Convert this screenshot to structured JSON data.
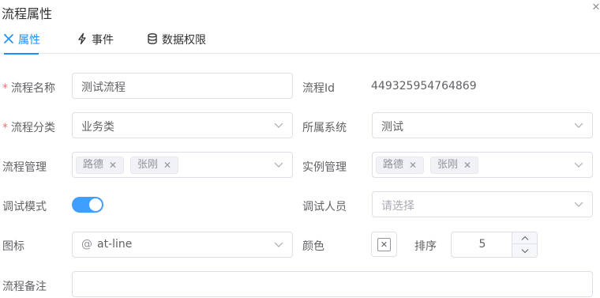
{
  "dialog": {
    "title": "流程属性",
    "close_icon": "close-icon"
  },
  "tabs": [
    {
      "label": "属性",
      "icon": "tools-icon",
      "active": true
    },
    {
      "label": "事件",
      "icon": "lightning-icon",
      "active": false
    },
    {
      "label": "数据权限",
      "icon": "database-icon",
      "active": false
    }
  ],
  "form": {
    "required_mark": "*",
    "process_name": {
      "label": "流程名称",
      "value": "测试流程"
    },
    "process_id": {
      "label": "流程Id",
      "value": "449325954764869"
    },
    "process_category": {
      "label": "流程分类",
      "value": "业务类"
    },
    "system": {
      "label": "所属系统",
      "value": "测试"
    },
    "process_admin": {
      "label": "流程管理",
      "tags": [
        "路德",
        "张刚"
      ]
    },
    "instance_admin": {
      "label": "实例管理",
      "tags": [
        "路德",
        "张刚"
      ]
    },
    "debug_mode": {
      "label": "调试模式",
      "on": true
    },
    "debug_users": {
      "label": "调试人员",
      "placeholder": "请选择"
    },
    "icon": {
      "label": "图标",
      "value": "at-line",
      "glyph": "@"
    },
    "color": {
      "label": "颜色",
      "clear_glyph": "✕"
    },
    "sort": {
      "label": "排序",
      "value": "5"
    },
    "remark": {
      "label": "流程备注",
      "value": ""
    }
  },
  "colors": {
    "accent": "#1890ff",
    "switch_on": "#409eff",
    "required": "#f56c6c",
    "border": "#dcdfe6"
  }
}
